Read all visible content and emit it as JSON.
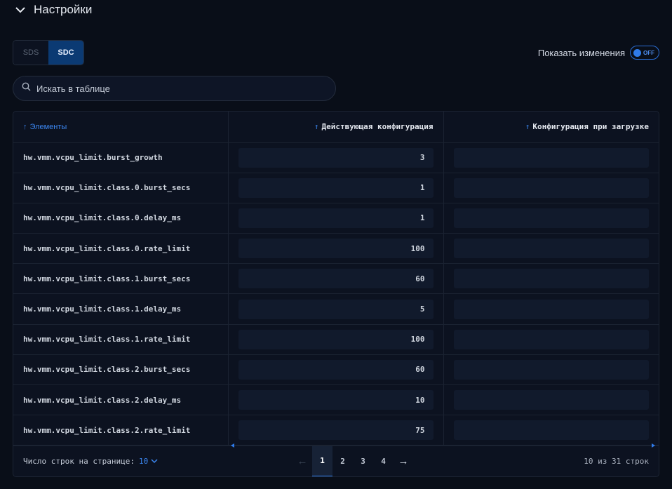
{
  "section": {
    "title": "Настройки"
  },
  "segments": [
    {
      "label": "SDS",
      "active": false
    },
    {
      "label": "SDC",
      "active": true
    }
  ],
  "show_changes": {
    "label": "Показать изменения",
    "toggle_label": "OFF",
    "on": false
  },
  "search": {
    "placeholder": "Искать в таблице",
    "value": ""
  },
  "table": {
    "columns": [
      {
        "label": "Элементы",
        "sort": "asc"
      },
      {
        "label": "Действующая конфигурация",
        "sort": "asc"
      },
      {
        "label": "Конфигурация при загрузке",
        "sort": "asc"
      }
    ],
    "rows": [
      {
        "name": "hw.vmm.vcpu_limit.burst_growth",
        "current": "3",
        "boot": ""
      },
      {
        "name": "hw.vmm.vcpu_limit.class.0.burst_secs",
        "current": "1",
        "boot": ""
      },
      {
        "name": "hw.vmm.vcpu_limit.class.0.delay_ms",
        "current": "1",
        "boot": ""
      },
      {
        "name": "hw.vmm.vcpu_limit.class.0.rate_limit",
        "current": "100",
        "boot": ""
      },
      {
        "name": "hw.vmm.vcpu_limit.class.1.burst_secs",
        "current": "60",
        "boot": ""
      },
      {
        "name": "hw.vmm.vcpu_limit.class.1.delay_ms",
        "current": "5",
        "boot": ""
      },
      {
        "name": "hw.vmm.vcpu_limit.class.1.rate_limit",
        "current": "100",
        "boot": ""
      },
      {
        "name": "hw.vmm.vcpu_limit.class.2.burst_secs",
        "current": "60",
        "boot": ""
      },
      {
        "name": "hw.vmm.vcpu_limit.class.2.delay_ms",
        "current": "10",
        "boot": ""
      },
      {
        "name": "hw.vmm.vcpu_limit.class.2.rate_limit",
        "current": "75",
        "boot": ""
      }
    ]
  },
  "footer": {
    "rows_per_page_label": "Число строк на странице:",
    "rows_per_page_value": "10",
    "pages": [
      "1",
      "2",
      "3",
      "4"
    ],
    "current_page": "1",
    "count_text": "10 из 31 строк"
  },
  "colors": {
    "accent": "#2f7bea",
    "background": "#090e18",
    "segment_active": "#0b3a73"
  }
}
